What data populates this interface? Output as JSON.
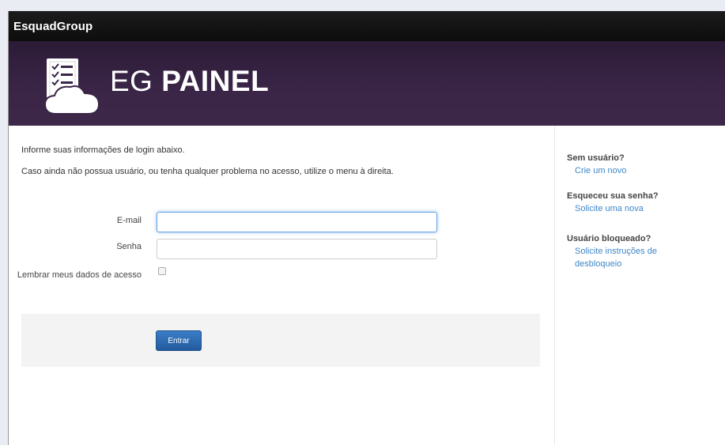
{
  "window": {
    "title": "EsquadGroup"
  },
  "banner": {
    "brand_prefix": "EG",
    "brand_name": "PAINEL"
  },
  "main": {
    "intro_line1": "Informe suas informações de login abaixo.",
    "intro_line2": "Caso ainda não possua usuário, ou tenha qualquer problema no acesso, utilize o menu à direita.",
    "email_label": "E-mail",
    "email_value": "",
    "password_label": "Senha",
    "password_value": "",
    "remember_label": "Lembrar meus dados de acesso",
    "remember_checked": false,
    "submit_label": "Entrar"
  },
  "sidebar": {
    "no_user": {
      "heading": "Sem usuário?",
      "link": "Crie um novo"
    },
    "forgot": {
      "heading": "Esqueceu sua senha?",
      "link": "Solicite uma nova"
    },
    "blocked": {
      "heading": "Usuário bloqueado?",
      "link": "Solicite instruções de desbloqueio"
    }
  },
  "colors": {
    "titlebar": "#111111",
    "banner": "#3a2547",
    "link": "#3f87c8",
    "button": "#2f6db4"
  },
  "icons": {
    "logo": "checklist-cloud-icon"
  }
}
